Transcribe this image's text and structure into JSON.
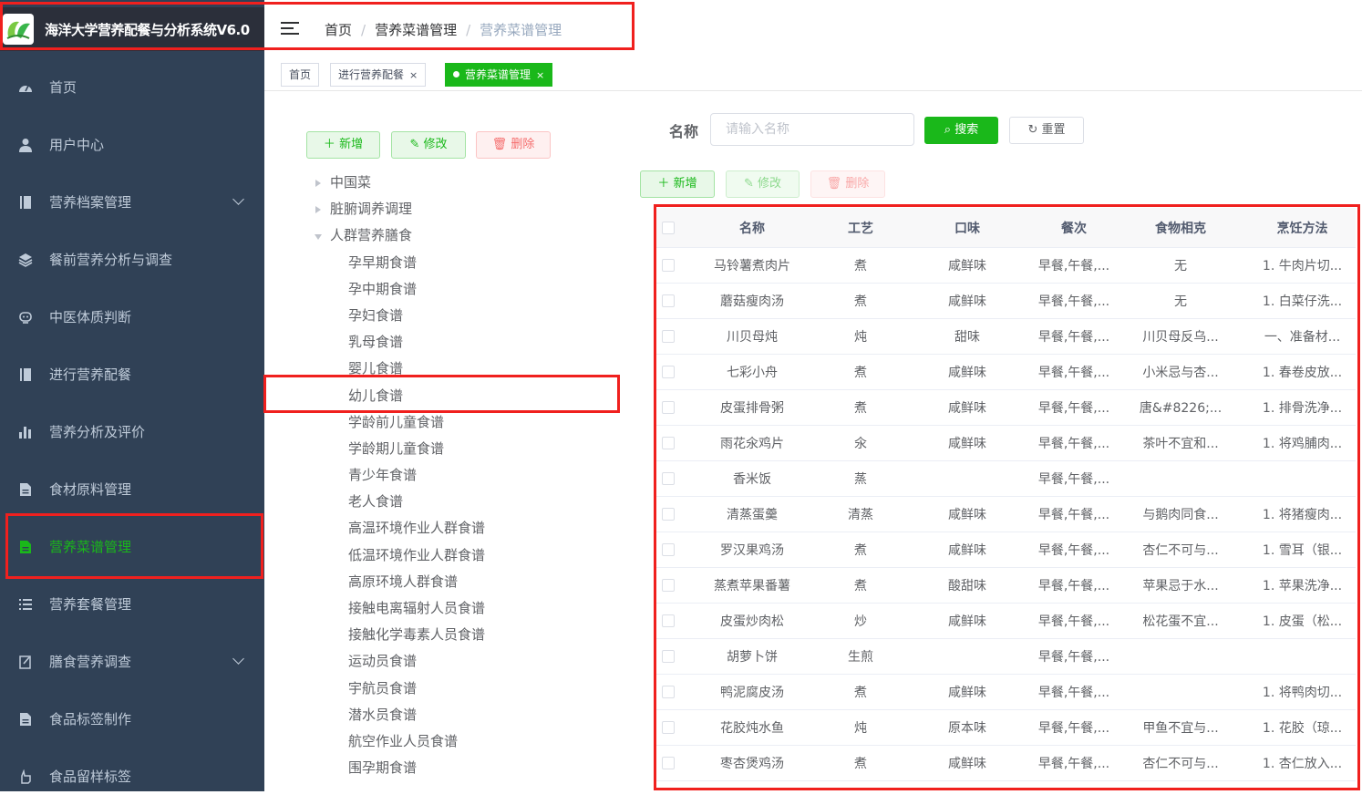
{
  "app": {
    "title": "海洋大学营养配餐与分析系统V6.0"
  },
  "sidebar": {
    "items": [
      {
        "label": "首页",
        "icon": "dashboard-icon"
      },
      {
        "label": "用户中心",
        "icon": "user-icon"
      },
      {
        "label": "营养档案管理",
        "icon": "book-icon",
        "expandable": true
      },
      {
        "label": "餐前营养分析与调查",
        "icon": "layers-icon"
      },
      {
        "label": "中医体质判断",
        "icon": "robot-icon"
      },
      {
        "label": "进行营养配餐",
        "icon": "book-icon"
      },
      {
        "label": "营养分析及评价",
        "icon": "bar-chart-icon"
      },
      {
        "label": "食材原料管理",
        "icon": "document-icon"
      },
      {
        "label": "营养菜谱管理",
        "icon": "document-icon",
        "active": true
      },
      {
        "label": "营养套餐管理",
        "icon": "list-icon"
      },
      {
        "label": "膳食营养调查",
        "icon": "edit-icon",
        "expandable": true
      },
      {
        "label": "食品标签制作",
        "icon": "document-icon"
      },
      {
        "label": "食品留样标签",
        "icon": "hand-icon"
      }
    ]
  },
  "breadcrumb": [
    "首页",
    "营养菜谱管理",
    "营养菜谱管理"
  ],
  "tags": [
    {
      "label": "首页"
    },
    {
      "label": "进行营养配餐",
      "close": "×"
    },
    {
      "label": "营养菜谱管理",
      "close": "×",
      "active": true
    }
  ],
  "left_toolbar": {
    "add": "新增",
    "edit": "修改",
    "delete": "删除"
  },
  "tree": [
    {
      "label": "中国菜",
      "level": 0,
      "caret": "right"
    },
    {
      "label": "脏腑调养调理",
      "level": 0,
      "caret": "right"
    },
    {
      "label": "人群营养膳食",
      "level": 0,
      "caret": "down"
    },
    {
      "label": "孕早期食谱",
      "level": 1
    },
    {
      "label": "孕中期食谱",
      "level": 1
    },
    {
      "label": "孕妇食谱",
      "level": 1
    },
    {
      "label": "乳母食谱",
      "level": 1
    },
    {
      "label": "婴儿食谱",
      "level": 1
    },
    {
      "label": "幼儿食谱",
      "level": 1
    },
    {
      "label": "学龄前儿童食谱",
      "level": 1
    },
    {
      "label": "学龄期儿童食谱",
      "level": 1
    },
    {
      "label": "青少年食谱",
      "level": 1
    },
    {
      "label": "老人食谱",
      "level": 1
    },
    {
      "label": "高温环境作业人群食谱",
      "level": 1
    },
    {
      "label": "低温环境作业人群食谱",
      "level": 1
    },
    {
      "label": "高原环境人群食谱",
      "level": 1
    },
    {
      "label": "接触电离辐射人员食谱",
      "level": 1
    },
    {
      "label": "接触化学毒素人员食谱",
      "level": 1
    },
    {
      "label": "运动员食谱",
      "level": 1
    },
    {
      "label": "宇航员食谱",
      "level": 1
    },
    {
      "label": "潜水员食谱",
      "level": 1
    },
    {
      "label": "航空作业人员食谱",
      "level": 1
    },
    {
      "label": "围孕期食谱",
      "level": 1
    }
  ],
  "search": {
    "label": "名称",
    "placeholder": "请输入名称",
    "search_btn": "搜索",
    "reset_btn": "重置"
  },
  "right_toolbar": {
    "add": "新增",
    "edit": "修改",
    "delete": "删除"
  },
  "table": {
    "headers": [
      "名称",
      "工艺",
      "口味",
      "餐次",
      "食物相克",
      "烹饪方法"
    ],
    "rows": [
      [
        "马铃薯煮肉片",
        "煮",
        "咸鲜味",
        "早餐,午餐,...",
        "无",
        "1. 牛肉片切..."
      ],
      [
        "蘑菇瘦肉汤",
        "煮",
        "咸鲜味",
        "早餐,午餐,...",
        "无",
        "1. 白菜仔洗..."
      ],
      [
        "川贝母炖",
        "炖",
        "甜味",
        "早餐,午餐,...",
        "川贝母反乌...",
        "一、准备材..."
      ],
      [
        "七彩小舟",
        "煮",
        "咸鲜味",
        "早餐,午餐,...",
        "小米忌与杏...",
        "1. 春卷皮放..."
      ],
      [
        "皮蛋排骨粥",
        "煮",
        "咸鲜味",
        "早餐,午餐,...",
        "唐&#8226;...",
        "1. 排骨洗净..."
      ],
      [
        "雨花氽鸡片",
        "氽",
        "咸鲜味",
        "早餐,午餐,...",
        "茶叶不宜和...",
        "1. 将鸡脯肉..."
      ],
      [
        "香米饭",
        "蒸",
        "",
        "早餐,午餐,...",
        "",
        ""
      ],
      [
        "清蒸蛋羹",
        "清蒸",
        "咸鲜味",
        "早餐,午餐,...",
        "与鹅肉同食...",
        "1. 将猪瘦肉..."
      ],
      [
        "罗汉果鸡汤",
        "煮",
        "咸鲜味",
        "早餐,午餐,...",
        "杏仁不可与...",
        "1. 雪耳（银..."
      ],
      [
        "蒸煮苹果番薯",
        "煮",
        "酸甜味",
        "早餐,午餐,...",
        "苹果忌于水...",
        "1. 苹果洗净..."
      ],
      [
        "皮蛋炒肉松",
        "炒",
        "咸鲜味",
        "早餐,午餐,...",
        "松花蛋不宜...",
        "1. 皮蛋（松..."
      ],
      [
        "胡萝卜饼",
        "生煎",
        "",
        "早餐,午餐,...",
        "",
        ""
      ],
      [
        "鸭泥腐皮汤",
        "煮",
        "咸鲜味",
        "早餐,午餐,...",
        "",
        "1. 将鸭肉切..."
      ],
      [
        "花胶炖水鱼",
        "炖",
        "原本味",
        "早餐,午餐,...",
        "甲鱼不宜与...",
        "1. 花胶（琼..."
      ],
      [
        "枣杏煲鸡汤",
        "煮",
        "咸鲜味",
        "早餐,午餐,...",
        "杏仁不可与...",
        "1. 杏仁放入..."
      ]
    ]
  },
  "colors": {
    "sidebar_bg": "#304156",
    "accent": "#1ab81a",
    "danger": "#f56c6c",
    "annotation": "#f0201e"
  }
}
